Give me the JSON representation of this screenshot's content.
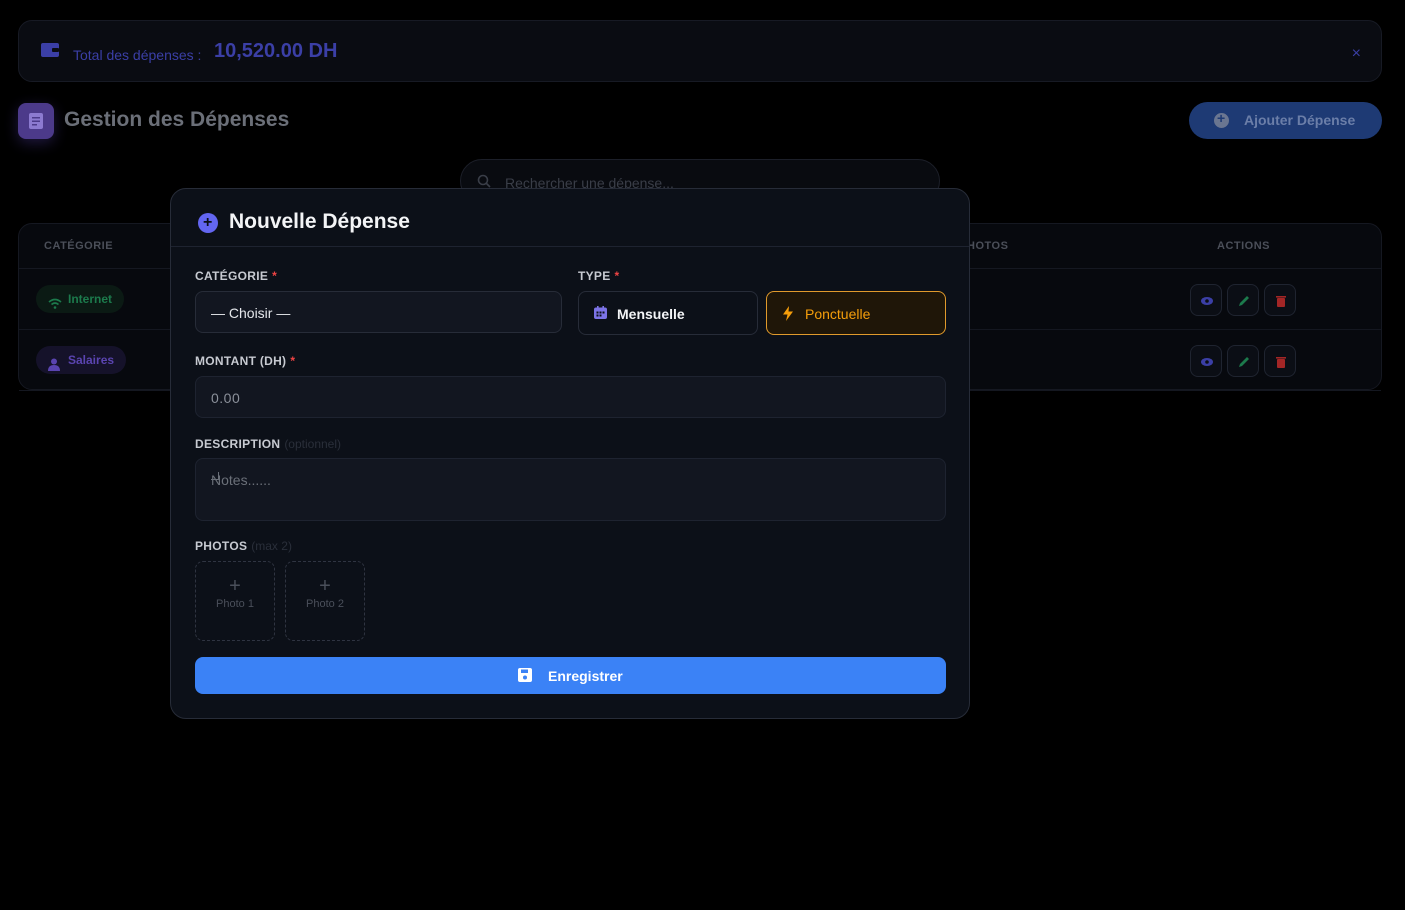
{
  "banner": {
    "label": "Total des dépenses :",
    "value": "10,520.00 DH",
    "close": "×"
  },
  "page": {
    "title": "Gestion des Dépenses",
    "add_button": "Ajouter Dépense"
  },
  "search": {
    "placeholder": "Rechercher une dépense..."
  },
  "table": {
    "headers": {
      "category": "CATÉGORIE",
      "photos_partial": "HOTOS",
      "actions": "ACTIONS"
    },
    "rows": [
      {
        "category": "Internet",
        "color": "#1c7a4c"
      },
      {
        "category": "Salaires",
        "color": "#5a44b0"
      }
    ]
  },
  "modal": {
    "title": "Nouvelle Dépense",
    "category": {
      "label": "CATÉGORIE",
      "required": "*",
      "value": "— Choisir —"
    },
    "type": {
      "label": "TYPE",
      "required": "*",
      "options": [
        "Mensuelle",
        "Ponctuelle"
      ],
      "selected": "Ponctuelle"
    },
    "amount": {
      "label": "MONTANT (DH)",
      "required": "*",
      "placeholder": "0.00"
    },
    "description": {
      "label": "DESCRIPTION",
      "optional": "(optionnel)",
      "placeholder": "Notes......"
    },
    "photos": {
      "label": "PHOTOS",
      "hint": "(max 2)",
      "slots": [
        "Photo 1",
        "Photo 2"
      ],
      "plus": "+"
    },
    "submit": "Enregistrer"
  },
  "colors": {
    "accent": "#3b82f6",
    "selected_type": "#f59e0b",
    "modal_icon": "#6366f1",
    "required": "#ef4444"
  }
}
